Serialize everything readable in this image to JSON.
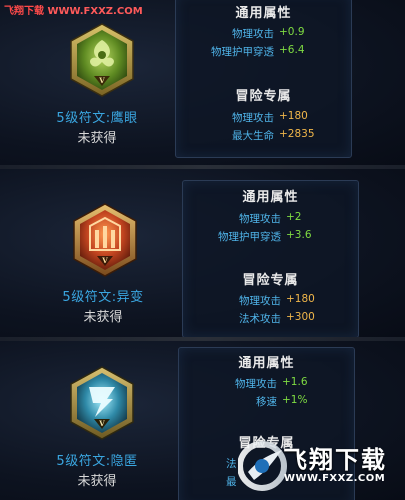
{
  "watermark": {
    "site_name": "飞翔下载",
    "site_url": "WWW.FXXZ.COM",
    "logo_text": "飞翔下载",
    "logo_url": "WWW.FXXZ.COM"
  },
  "runes": [
    {
      "name": "5级符文:鹰眼",
      "status": "未获得",
      "level_mark": "V",
      "icon": "green-eagle-eye-rune-icon",
      "color": "#7aa83a",
      "general_title": "通用属性",
      "general": [
        {
          "label": "物理攻击",
          "value": "+0.9"
        },
        {
          "label": "物理护甲穿透",
          "value": "+6.4"
        }
      ],
      "adventure_title": "冒险专属",
      "adventure": [
        {
          "label": "物理攻击",
          "value": "+180"
        },
        {
          "label": "最大生命",
          "value": "+2835"
        }
      ]
    },
    {
      "name": "5级符文:异变",
      "status": "未获得",
      "level_mark": "V",
      "icon": "red-mutation-rune-icon",
      "color": "#c8502a",
      "general_title": "通用属性",
      "general": [
        {
          "label": "物理攻击",
          "value": "+2"
        },
        {
          "label": "物理护甲穿透",
          "value": "+3.6"
        }
      ],
      "adventure_title": "冒险专属",
      "adventure": [
        {
          "label": "物理攻击",
          "value": "+180"
        },
        {
          "label": "法术攻击",
          "value": "+300"
        }
      ]
    },
    {
      "name": "5级符文:隐匿",
      "status": "未获得",
      "level_mark": "V",
      "icon": "blue-stealth-rune-icon",
      "color": "#3aa6c8",
      "general_title": "通用属性",
      "general": [
        {
          "label": "物理攻击",
          "value": "+1.6"
        },
        {
          "label": "移速",
          "value": "+1%"
        }
      ],
      "adventure_title": "冒险专属",
      "adventure": [
        {
          "label": "法",
          "value": ""
        },
        {
          "label": "最",
          "value": ""
        }
      ]
    }
  ]
}
